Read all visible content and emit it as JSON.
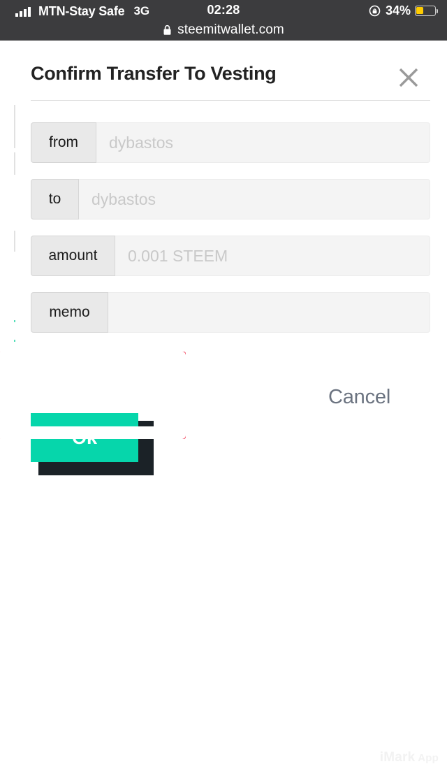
{
  "statusbar": {
    "signal_icon": "signal-bars-icon",
    "carrier": "MTN-Stay Safe",
    "network_type": "3G",
    "clock": "02:28",
    "rotation_lock_icon": "rotation-lock-icon",
    "battery_percent": "34%",
    "battery_level": 34,
    "battery_color": "#ffcc00",
    "lock_icon": "padlock-icon",
    "url": "steemitwallet.com",
    "background": "#3c3c3e"
  },
  "modal": {
    "title": "Confirm Transfer To Vesting",
    "close_icon": "close-x-icon",
    "fields": [
      {
        "label": "from",
        "value": "",
        "placeholder": "dybastos"
      },
      {
        "label": "to",
        "value": "",
        "placeholder": "dybastos"
      },
      {
        "label": "amount",
        "value": "",
        "placeholder": "0.001 STEEM"
      },
      {
        "label": "memo",
        "value": "",
        "placeholder": ""
      }
    ],
    "confirm_label": "Ok",
    "cancel_label": "Cancel",
    "confirm_color": "#06d6ab",
    "confirm_shadow_color": "#1b2227",
    "cancel_color": "#6b7380"
  },
  "annotation": {
    "highlight_color": "#f0213f",
    "target": "Ok"
  },
  "watermark": {
    "text": "iMark",
    "suffix": " App"
  }
}
